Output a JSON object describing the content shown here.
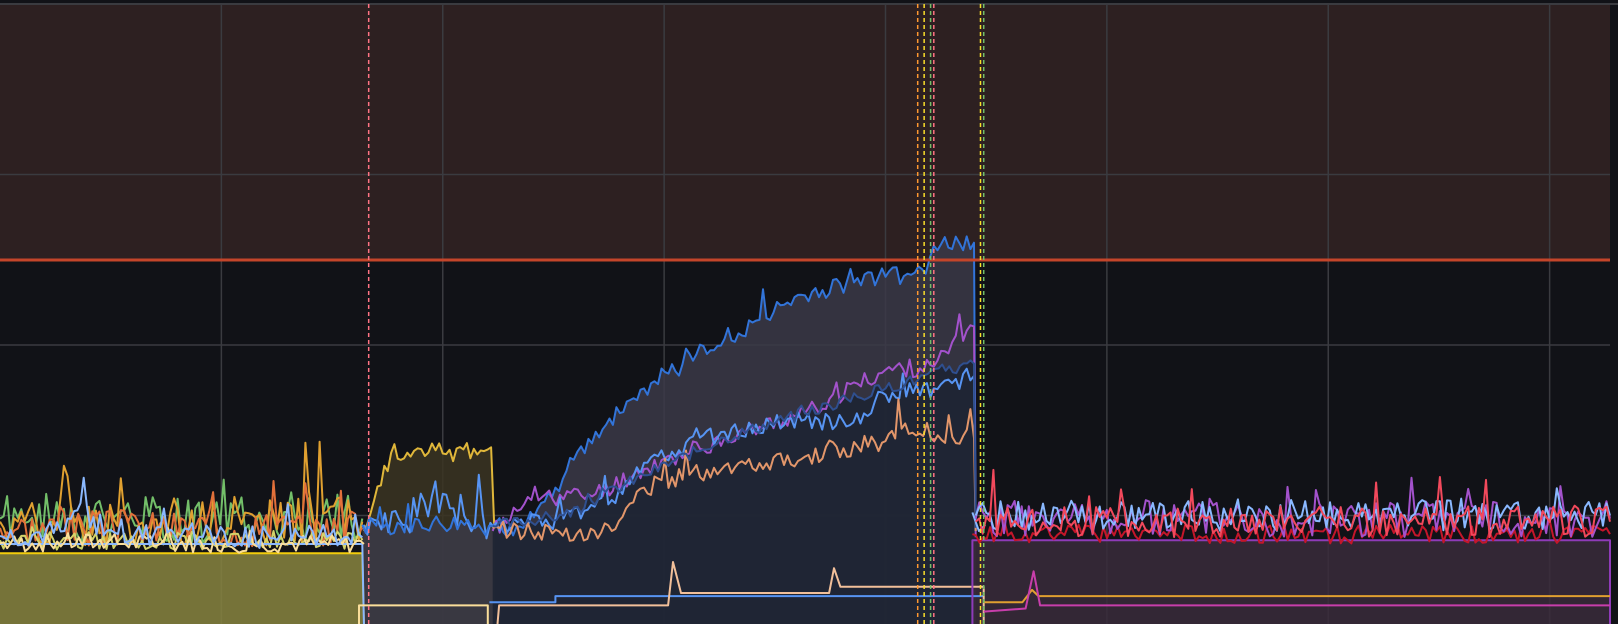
{
  "chart_data": {
    "type": "line",
    "title": "",
    "xlabel": "",
    "ylabel": "",
    "grid": true,
    "legend": "none",
    "xlim": [
      0,
      100
    ],
    "ylim": [
      0,
      100
    ],
    "grid_x": [
      13.75,
      27.5,
      41.25,
      55,
      68.75,
      82.5,
      96.25
    ],
    "grid_y": [
      72.5,
      45,
      17.5
    ],
    "threshold": {
      "value": 58.7,
      "color": "#c4452a",
      "region_color": "#2d2021"
    },
    "annotations": [
      {
        "x": 22.9,
        "color": "#ff7383"
      },
      {
        "x": 57.0,
        "color": "#ff9830"
      },
      {
        "x": 57.4,
        "color": "#fade2a"
      },
      {
        "x": 57.8,
        "color": "#73bf69"
      },
      {
        "x": 58.0,
        "color": "#ff7383"
      },
      {
        "x": 60.9,
        "color": "#fade2a"
      },
      {
        "x": 61.1,
        "color": "#73bf69"
      }
    ],
    "series": [
      {
        "color": "#73bf69",
        "fill": false,
        "noise": [
          4.0,
          12.0
        ],
        "seed": 1,
        "points": [
          [
            0,
            17
          ],
          [
            22.5,
            17
          ]
        ]
      },
      {
        "color": "#e0a030",
        "fill": false,
        "noise": [
          4.0,
          11.0
        ],
        "seed": 2,
        "points": [
          [
            0,
            16.5
          ],
          [
            22.5,
            16.5
          ]
        ]
      },
      {
        "color": "#e2703a",
        "fill": false,
        "noise": [
          3.0,
          8.0
        ],
        "seed": 3,
        "points": [
          [
            0,
            15.5
          ],
          [
            22.5,
            15.5
          ]
        ]
      },
      {
        "color": "#d3d36a",
        "fill": false,
        "noise": [
          1.5,
          2.5
        ],
        "seed": 4,
        "points": [
          [
            0,
            13.5
          ],
          [
            22.5,
            13.5
          ]
        ]
      },
      {
        "color": "#f2cc0c",
        "fill": true,
        "fillcolor": "#888540",
        "noise": [
          0,
          0
        ],
        "seed": 5,
        "points": [
          [
            0,
            11.4
          ],
          [
            22.5,
            11.4
          ],
          [
            22.6,
            0
          ]
        ]
      },
      {
        "color": "#8ab8ff",
        "fill": false,
        "noise": [
          0,
          0
        ],
        "seed": 6,
        "points": [
          [
            0,
            12.9
          ],
          [
            22.5,
            12.9
          ],
          [
            22.6,
            0
          ]
        ]
      },
      {
        "color": "#fade9a",
        "fill": false,
        "noise": [
          1.5,
          3.0
        ],
        "seed": 7,
        "points": [
          [
            0,
            13.0
          ],
          [
            2.0,
            13.0
          ],
          [
            4.0,
            13.2
          ],
          [
            10.0,
            13.0
          ],
          [
            17.5,
            13.0
          ],
          [
            22.6,
            12.9
          ]
        ]
      },
      {
        "color": "#e0b73a",
        "fill": true,
        "fillcolor": "#3b3522",
        "noise": [
          2.0,
          6.0
        ],
        "seed": 8,
        "points": [
          [
            22.6,
            15.0
          ],
          [
            24.5,
            29.0
          ],
          [
            25.5,
            27.0
          ],
          [
            27.5,
            27.5
          ],
          [
            30.5,
            28.5
          ],
          [
            30.7,
            15.5
          ]
        ]
      },
      {
        "color": "#5794f2",
        "fill": false,
        "noise": [
          3.0,
          8.0
        ],
        "seed": 9,
        "points": [
          [
            22.6,
            16.0
          ],
          [
            25.0,
            16.0
          ],
          [
            27.5,
            21.0
          ],
          [
            29.5,
            16.0
          ],
          [
            30.7,
            15.5
          ]
        ]
      },
      {
        "color": "#3274d9",
        "fill": true,
        "fillcolor": "#3b3a48",
        "noise": [
          1.5,
          4.0
        ],
        "seed": 10,
        "points": [
          [
            22.5,
            16.0
          ],
          [
            30.6,
            15.8
          ],
          [
            32.5,
            15.5
          ],
          [
            34.5,
            22.0
          ],
          [
            37.0,
            31.0
          ],
          [
            40.0,
            38.0
          ],
          [
            45.0,
            46.0
          ],
          [
            50.0,
            53.0
          ],
          [
            55.0,
            56.0
          ],
          [
            57.5,
            56.5
          ],
          [
            58.0,
            61.0
          ],
          [
            60.5,
            61.5
          ],
          [
            60.6,
            15.5
          ]
        ]
      },
      {
        "color": "#a352cc",
        "fill": false,
        "noise": [
          1.5,
          4.0
        ],
        "seed": 11,
        "points": [
          [
            30.6,
            15.0
          ],
          [
            33.0,
            20.0
          ],
          [
            37.0,
            21.0
          ],
          [
            40.0,
            25.0
          ],
          [
            45.0,
            30.0
          ],
          [
            50.0,
            34.0
          ],
          [
            55.0,
            41.0
          ],
          [
            58.0,
            41.5
          ],
          [
            60.5,
            48.0
          ],
          [
            60.6,
            14.0
          ]
        ]
      },
      {
        "color": "#5794f2",
        "fill": false,
        "noise": [
          1.5,
          4.0
        ],
        "seed": 12,
        "points": [
          [
            30.6,
            15.5
          ],
          [
            35.0,
            17.0
          ],
          [
            38.0,
            20.0
          ],
          [
            40.0,
            26.0
          ],
          [
            45.0,
            31.0
          ],
          [
            50.0,
            33.0
          ],
          [
            53.0,
            32.5
          ],
          [
            55.0,
            37.0
          ],
          [
            58.0,
            38.0
          ],
          [
            60.5,
            40.0
          ],
          [
            60.6,
            15.0
          ]
        ]
      },
      {
        "color": "#e2966a",
        "fill": false,
        "noise": [
          1.5,
          4.0
        ],
        "seed": 13,
        "points": [
          [
            30.6,
            15.5
          ],
          [
            33.0,
            14.8
          ],
          [
            38.0,
            15.0
          ],
          [
            40.0,
            22.0
          ],
          [
            45.0,
            25.5
          ],
          [
            50.0,
            27.0
          ],
          [
            55.0,
            29.5
          ],
          [
            56.0,
            31.5
          ],
          [
            60.5,
            30.0
          ],
          [
            60.6,
            15.0
          ]
        ]
      },
      {
        "color": "#2f4f8f",
        "fill": true,
        "fillcolor": "#1c2333",
        "noise": [
          1.0,
          2.5
        ],
        "seed": 14,
        "points": [
          [
            30.6,
            15.8
          ],
          [
            35.0,
            17.5
          ],
          [
            40.0,
            24.0
          ],
          [
            45.0,
            30.0
          ],
          [
            50.0,
            34.0
          ],
          [
            55.0,
            38.0
          ],
          [
            60.5,
            42.0
          ],
          [
            60.6,
            15.5
          ]
        ]
      },
      {
        "color": "#fade9a",
        "fill": false,
        "noise": [
          0,
          0
        ],
        "seed": 15,
        "points": [
          [
            22.3,
            0
          ],
          [
            22.3,
            3.0
          ],
          [
            30.3,
            3.0
          ],
          [
            30.3,
            0
          ]
        ]
      },
      {
        "color": "#5794f2",
        "fill": false,
        "noise": [
          0,
          0
        ],
        "seed": 16,
        "points": [
          [
            30.4,
            3.5
          ],
          [
            34.5,
            3.5
          ],
          [
            34.5,
            4.5
          ],
          [
            61.1,
            4.5
          ]
        ]
      },
      {
        "color": "#f2c09a",
        "fill": false,
        "noise": [
          0,
          0
        ],
        "seed": 17,
        "points": [
          [
            30.9,
            0
          ],
          [
            31.0,
            3.0
          ],
          [
            41.5,
            3.0
          ],
          [
            41.8,
            10.0
          ],
          [
            42.3,
            5.0
          ],
          [
            51.5,
            5.0
          ],
          [
            51.8,
            9.0
          ],
          [
            52.2,
            6.0
          ],
          [
            61.1,
            6.0
          ],
          [
            61.1,
            0
          ]
        ]
      },
      {
        "color": "#8ab8ff",
        "fill": false,
        "noise": [
          0,
          0
        ],
        "seed": 18,
        "points": [
          [
            60.4,
            18.0
          ],
          [
            60.8,
            15.0
          ],
          [
            61.2,
            16.0
          ]
        ]
      },
      {
        "color": "#8f3bb8",
        "fill": true,
        "fillcolor": "#3a2b3b",
        "noise": [
          0,
          0
        ],
        "seed": 19,
        "points": [
          [
            60.4,
            0
          ],
          [
            60.4,
            13.5
          ],
          [
            100,
            13.5
          ],
          [
            100,
            0
          ]
        ]
      },
      {
        "color": "#c4162a",
        "fill": false,
        "noise": [
          1.5,
          2.5
        ],
        "seed": 20,
        "points": [
          [
            60.4,
            14.5
          ],
          [
            100,
            14.5
          ]
        ]
      },
      {
        "color": "#e0a030",
        "fill": false,
        "noise": [
          0,
          0
        ],
        "seed": 21,
        "points": [
          [
            61.1,
            3.5
          ],
          [
            63.5,
            3.5
          ],
          [
            64.1,
            5.5
          ],
          [
            64.5,
            4.5
          ],
          [
            100,
            4.5
          ]
        ]
      },
      {
        "color": "#c83eab",
        "fill": false,
        "noise": [
          0,
          0
        ],
        "seed": 22,
        "points": [
          [
            61.1,
            2.0
          ],
          [
            63.7,
            2.5
          ],
          [
            64.2,
            8.5
          ],
          [
            64.6,
            3.0
          ],
          [
            100,
            3.0
          ]
        ]
      },
      {
        "color": "#a352cc",
        "fill": false,
        "noise": [
          3.0,
          8.0
        ],
        "seed": 23,
        "points": [
          [
            60.6,
            17.0
          ],
          [
            100,
            17.0
          ]
        ]
      },
      {
        "color": "#8ab8ff",
        "fill": false,
        "noise": [
          2.5,
          6.0
        ],
        "seed": 24,
        "points": [
          [
            60.6,
            17.5
          ],
          [
            100,
            17.5
          ]
        ]
      },
      {
        "color": "#f2495c",
        "fill": false,
        "noise": [
          2.5,
          7.0
        ],
        "seed": 25,
        "points": [
          [
            60.6,
            16.5
          ],
          [
            100,
            16.5
          ]
        ]
      },
      {
        "color": "#8ab8ff",
        "fill": false,
        "noise": [
          2.0,
          5.0
        ],
        "seed": 26,
        "points": [
          [
            0,
            14.2
          ],
          [
            4.0,
            15.0
          ],
          [
            5.0,
            19.5
          ],
          [
            6.0,
            14.5
          ],
          [
            22.5,
            14.0
          ]
        ]
      }
    ]
  }
}
